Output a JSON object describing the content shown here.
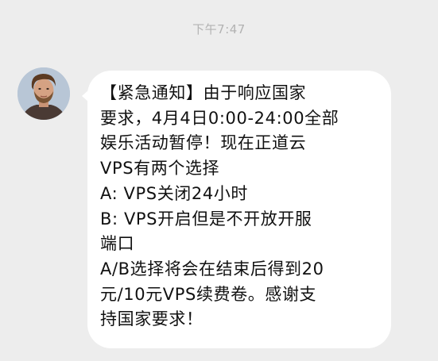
{
  "chat": {
    "timestamp": "下午7:47",
    "sender": {
      "avatar_icon": "person-portrait-avatar"
    },
    "message": {
      "lines": [
        "【紧急通知】由于响应国家",
        "要求，4月4日0:00-24:00全部",
        "娱乐活动暂停！现在正道云",
        "VPS有两个选择",
        "A: VPS关闭24小时",
        "B: VPS开启但是不开放开服",
        "端口",
        "A/B选择将会在结束后得到20",
        "元/10元VPS续费卷。感谢支",
        "持国家要求！"
      ]
    }
  }
}
